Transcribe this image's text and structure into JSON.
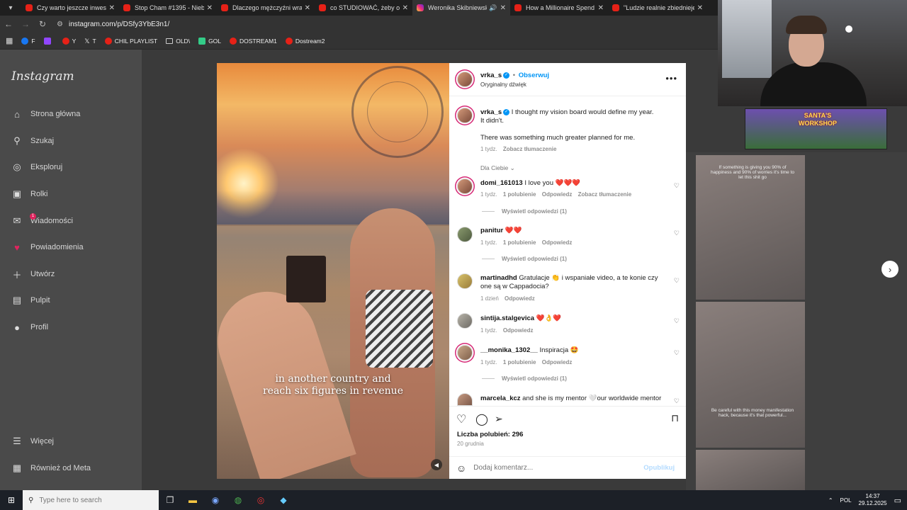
{
  "browser": {
    "tabs": [
      {
        "title": "Czy warto jeszcze inwesto",
        "icon": "youtube-icon",
        "active": false
      },
      {
        "title": "Stop Cham #1395 - Nieb",
        "icon": "youtube-icon",
        "active": false
      },
      {
        "title": "Dlaczego mężczyźni wrac",
        "icon": "youtube-icon",
        "active": false
      },
      {
        "title": "co STUDIOWAĆ, żeby osi",
        "icon": "youtube-icon",
        "active": false
      },
      {
        "title": "Weronika Skibniewsk",
        "icon": "instagram-icon",
        "active": true
      },
      {
        "title": "How a Millionaire Spend",
        "icon": "youtube-icon",
        "active": false
      },
      {
        "title": "\"Ludzie realnie zbiednieje",
        "icon": "youtube-icon",
        "active": false
      }
    ],
    "url": "instagram.com/p/DSfy3YbE3n1/",
    "bookmarks": [
      "F",
      "",
      "Y",
      "T",
      "CHIL PLAYLIST",
      "OLD\\",
      "GOL",
      "DOSTREAM1",
      "Dostream2"
    ]
  },
  "sidebar": {
    "logo": "Instagram",
    "items": [
      {
        "label": "Strona główna",
        "icon": "home-icon"
      },
      {
        "label": "Szukaj",
        "icon": "search-icon"
      },
      {
        "label": "Eksploruj",
        "icon": "compass-icon"
      },
      {
        "label": "Rolki",
        "icon": "reels-icon"
      },
      {
        "label": "Wiadomości",
        "icon": "messenger-icon"
      },
      {
        "label": "Powiadomienia",
        "icon": "heart-icon"
      },
      {
        "label": "Utwórz",
        "icon": "plus-icon"
      },
      {
        "label": "Pulpit",
        "icon": "dashboard-icon"
      },
      {
        "label": "Profil",
        "icon": "profile-icon"
      }
    ],
    "messages_badge": "1",
    "more": "Więcej",
    "meta": "Również od Meta"
  },
  "post": {
    "video_subtitle": [
      "in another country and",
      "reach six figures in revenue"
    ],
    "header": {
      "username": "vrka_s",
      "follow": "Obserwuj",
      "audio": "Oryginalny dźwięk",
      "separator": "•"
    },
    "caption": {
      "username": "vrka_s",
      "line1": "I thought my vision board would define my year.",
      "line2": "It didn't.",
      "line3": "There was something much greater planned for me.",
      "time": "1 tydz.",
      "translate": "Zobacz tłumaczenie"
    },
    "filter": "Dla Ciebie",
    "comments": [
      {
        "username": "domi_161013",
        "text": "I love you ❤️❤️❤️",
        "time": "1 tydz.",
        "likes": "1 polubienie",
        "reply": "Odpowiedz",
        "translate": "Zobacz tłumaczenie",
        "view_replies": "Wyświetl odpowiedzi (1)"
      },
      {
        "username": "panitur",
        "text": "❤️❤️",
        "time": "1 tydz.",
        "likes": "1 polubienie",
        "reply": "Odpowiedz",
        "view_replies": "Wyświetl odpowiedzi (1)"
      },
      {
        "username": "martinadhd",
        "text": "Gratulacje 👏 i wspaniałe video, a te konie czy",
        "text2": "one są w Cappadocia?",
        "time": "1 dzień",
        "reply": "Odpowiedz"
      },
      {
        "username": "sintija.stalgevica",
        "text": "❤️👌❤️",
        "time": "1 tydz.",
        "reply": "Odpowiedz"
      },
      {
        "username": "__monika_1302__",
        "text": "Inspiracja 🤩",
        "time": "1 tydz.",
        "likes": "1 polubienie",
        "reply": "Odpowiedz",
        "view_replies": "Wyświetl odpowiedzi (1)"
      },
      {
        "username": "marcela_kcz",
        "text": "and she is my mentor 🤍our worldwide mentor"
      }
    ],
    "likes": "Liczba polubień: 296",
    "date": "20 grudnia",
    "comment_placeholder": "Dodaj komentarz...",
    "publish": "Opublikuj"
  },
  "background_thumbs": [
    {
      "caption": "If something is giving you 90% of happiness and 90% of worries it's time to let this shit go"
    },
    {
      "caption": "Be careful with this money manifestation hack, because it's that powerful..."
    }
  ],
  "ad": {
    "title_line1": "SANTA'S",
    "title_line2": "WORKSHOP"
  },
  "taskbar": {
    "search_placeholder": "Type here to search",
    "lang": "POL",
    "time": "14:37",
    "date": "29.12.2025"
  }
}
